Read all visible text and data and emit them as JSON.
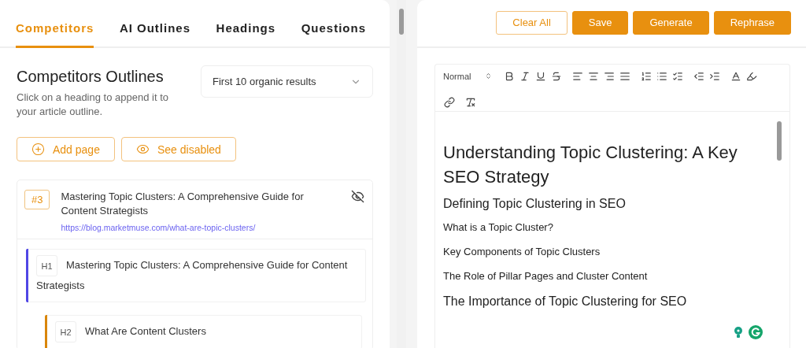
{
  "tabs": [
    {
      "label": "Competitors",
      "selected": true
    },
    {
      "label": "AI Outlines",
      "selected": false
    },
    {
      "label": "Headings",
      "selected": false
    },
    {
      "label": "Questions",
      "selected": false
    }
  ],
  "competitors": {
    "title": "Competitors Outlines",
    "description": "Click on a heading to append it to your article outline.",
    "filter": {
      "value": "First 10 organic results"
    },
    "buttons": [
      {
        "kind": "add",
        "label": "Add page"
      },
      {
        "kind": "view",
        "label": "See disabled"
      }
    ],
    "result": {
      "rank": "#3",
      "title": "Mastering Topic Clusters: A Comprehensive Guide for Content Strategists",
      "url": "https://blog.marketmuse.com/what-are-topic-clusters/",
      "outline": [
        {
          "tag": "H1",
          "text": "Mastering Topic Clusters: A Comprehensive Guide for Content Strategists",
          "color": "#5046e5",
          "children": [
            {
              "tag": "H2",
              "text": "What Are Content Clusters",
              "color": "#d9860b"
            }
          ]
        }
      ]
    }
  },
  "actions": [
    {
      "label": "Clear All",
      "kind": "outline"
    },
    {
      "label": "Save",
      "kind": "filled"
    },
    {
      "label": "Generate",
      "kind": "filled"
    },
    {
      "label": "Rephrase",
      "kind": "filled"
    }
  ],
  "editor": {
    "style": "Normal",
    "content": [
      {
        "kind": "h1",
        "text": "Understanding Topic Clustering: A Key SEO Strategy"
      },
      {
        "kind": "h2",
        "text": "Defining Topic Clustering in SEO"
      },
      {
        "kind": "h3",
        "text": "What is a Topic Cluster?"
      },
      {
        "kind": "h3",
        "text": "Key Components of Topic Clusters"
      },
      {
        "kind": "h3",
        "text": "The Role of Pillar Pages and Cluster Content"
      },
      {
        "kind": "h2",
        "text": "The Importance of Topic Clustering for SEO"
      }
    ]
  }
}
